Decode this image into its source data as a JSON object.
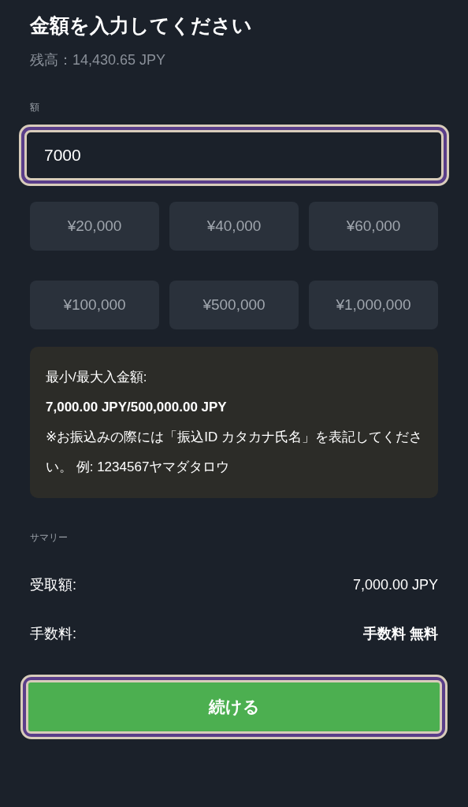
{
  "title": "金額を入力してください",
  "balance": "残高：14,430.65 JPY",
  "amount_field": {
    "label": "額",
    "value": "7000",
    "focused": true
  },
  "presets": [
    {
      "label": "¥20,000",
      "selected": false
    },
    {
      "label": "¥40,000",
      "selected": false
    },
    {
      "label": "¥60,000",
      "selected": false
    },
    {
      "label": "¥100,000",
      "selected": false
    },
    {
      "label": "¥500,000",
      "selected": false
    },
    {
      "label": "¥1,000,000",
      "selected": false
    }
  ],
  "limits": {
    "label": "最小/最大入金額:",
    "range": "7,000.00 JPY/500,000.00 JPY",
    "note": "※お振込みの際には「振込ID カタカナ氏名」を表記してください。 例: 1234567ヤマダタロウ"
  },
  "summary": {
    "heading": "サマリー",
    "rows": [
      {
        "label": "受取額:",
        "value": "7,000.00 JPY",
        "bold": false
      },
      {
        "label": "手数料:",
        "value": "手数料 無料",
        "bold": true
      }
    ]
  },
  "continue_button": {
    "label": "続ける",
    "focused": true
  }
}
